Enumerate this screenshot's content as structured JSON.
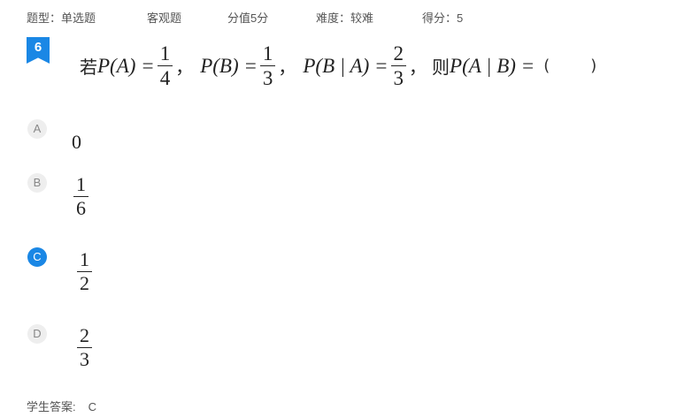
{
  "meta": {
    "type": "题型：单选题",
    "category": "客观题",
    "score_value": "分值5分",
    "difficulty": "难度：较难",
    "score_got": "得分：5"
  },
  "question": {
    "number": "6",
    "prefix": "若",
    "pa_lhs": "P(A) =",
    "pa_num": "1",
    "pa_den": "4",
    "sep1": "，",
    "pb_lhs": "P(B) =",
    "pb_num": "1",
    "pb_den": "3",
    "sep2": "，",
    "pba_lhs": "P(B | A) =",
    "pba_num": "2",
    "pba_den": "3",
    "sep3": "，",
    "then": "则",
    "pab_lhs": "P(A | B) =",
    "paren_open": "(",
    "paren_close": ")"
  },
  "options": [
    {
      "letter": "A",
      "value": "0",
      "selected": false
    },
    {
      "letter": "B",
      "num": "1",
      "den": "6",
      "selected": false
    },
    {
      "letter": "C",
      "num": "1",
      "den": "2",
      "selected": true
    },
    {
      "letter": "D",
      "num": "2",
      "den": "3",
      "selected": false
    }
  ],
  "answer": {
    "label": "学生答案:",
    "value": "C"
  },
  "colors": {
    "accent": "#1a87e5",
    "badge_bg": "#eeeeee"
  }
}
